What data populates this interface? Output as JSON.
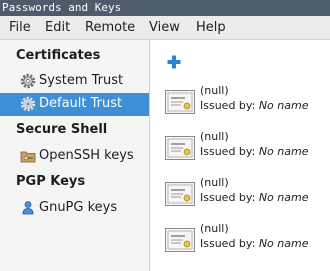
{
  "window": {
    "title": "Passwords and Keys"
  },
  "menu": {
    "file": "File",
    "edit": "Edit",
    "remote": "Remote",
    "view": "View",
    "help": "Help"
  },
  "sidebar": {
    "certificates": {
      "header": "Certificates",
      "items": [
        {
          "label": "System Trust",
          "icon": "gear-icon",
          "selected": false
        },
        {
          "label": "Default Trust",
          "icon": "gear-icon",
          "selected": true
        }
      ]
    },
    "secure_shell": {
      "header": "Secure Shell",
      "items": [
        {
          "label": "OpenSSH keys",
          "icon": "key-folder-icon"
        }
      ]
    },
    "pgp_keys": {
      "header": "PGP Keys",
      "items": [
        {
          "label": "GnuPG keys",
          "icon": "person-key-icon"
        }
      ]
    }
  },
  "toolbar": {
    "add_icon": "plus-icon"
  },
  "certificates": [
    {
      "name": "(null)",
      "issued_label": "Issued by:",
      "issuer": "No name"
    },
    {
      "name": "(null)",
      "issued_label": "Issued by:",
      "issuer": "No name"
    },
    {
      "name": "(null)",
      "issued_label": "Issued by:",
      "issuer": "No name"
    },
    {
      "name": "(null)",
      "issued_label": "Issued by:",
      "issuer": "No name"
    }
  ],
  "colors": {
    "selection": "#3d8fd6",
    "titlebar": "#4e5b6b",
    "add_icon": "#2f7fd3"
  }
}
